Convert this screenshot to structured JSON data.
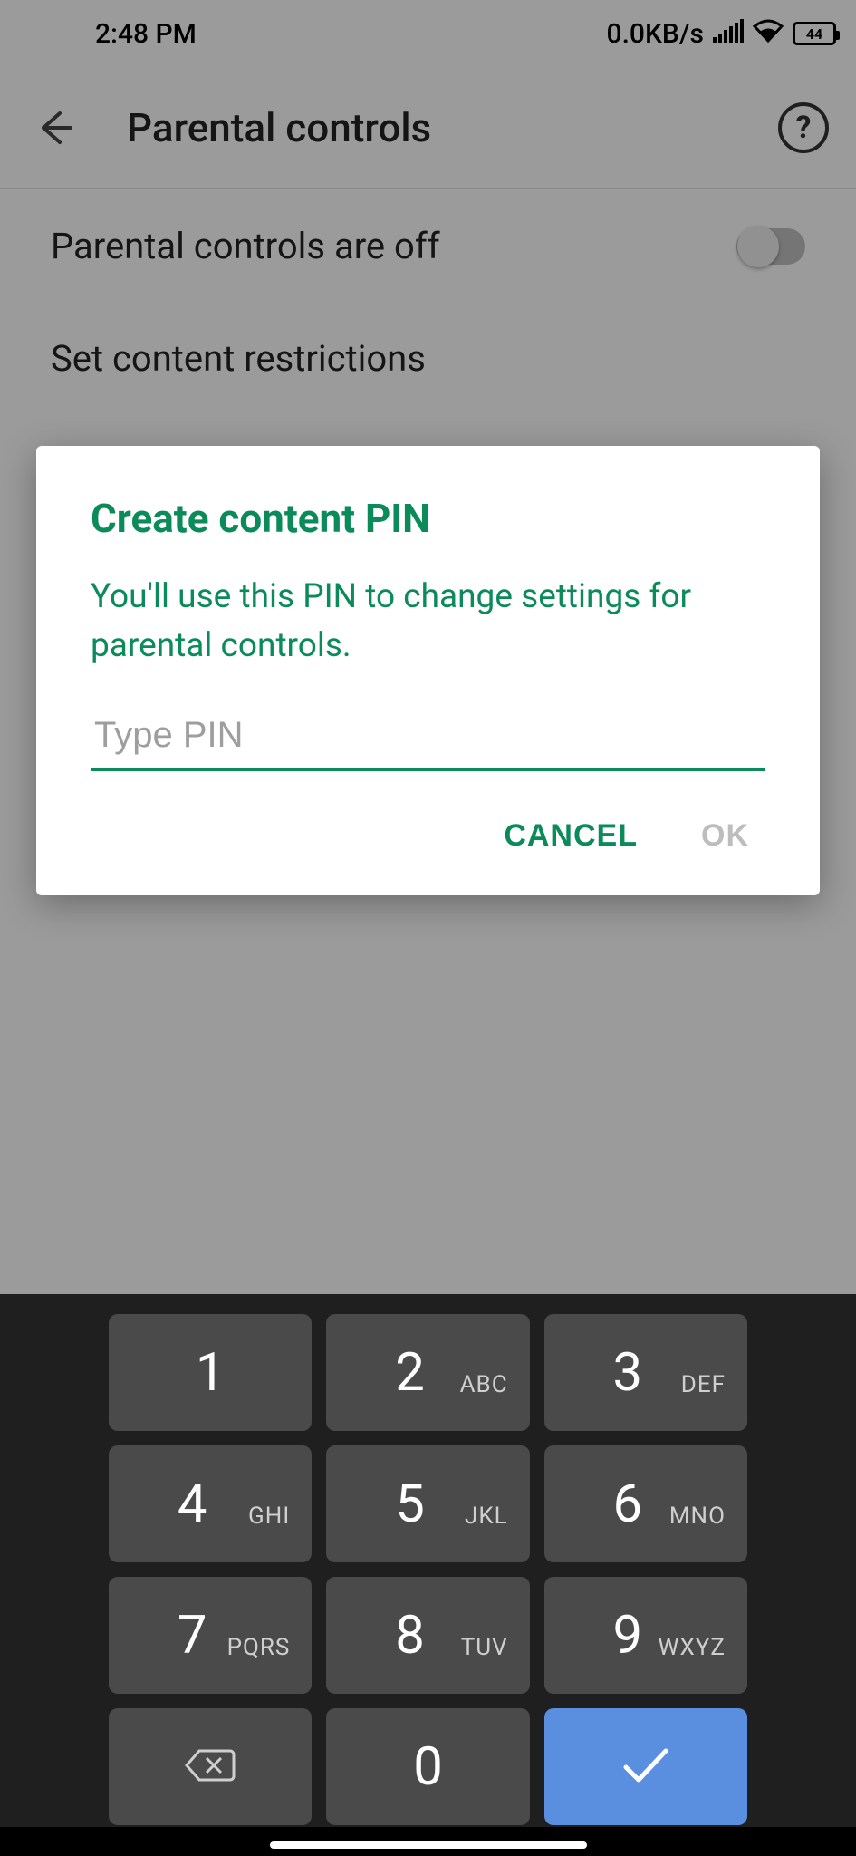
{
  "statusbar": {
    "time": "2:48 PM",
    "net_speed": "0.0KB/s",
    "battery_pct": "44"
  },
  "appbar": {
    "title": "Parental controls"
  },
  "page": {
    "toggle_row_label": "Parental controls are off",
    "section_label": "Set content restrictions"
  },
  "dialog": {
    "title": "Create content PIN",
    "body": "You'll use this PIN to change settings for parental controls.",
    "placeholder": "Type PIN",
    "cancel_label": "CANCEL",
    "ok_label": "OK"
  },
  "keyboard": {
    "keys": [
      {
        "num": "1",
        "sub": ""
      },
      {
        "num": "2",
        "sub": "ABC"
      },
      {
        "num": "3",
        "sub": "DEF"
      },
      {
        "num": "4",
        "sub": "GHI"
      },
      {
        "num": "5",
        "sub": "JKL"
      },
      {
        "num": "6",
        "sub": "MNO"
      },
      {
        "num": "7",
        "sub": "PQRS"
      },
      {
        "num": "8",
        "sub": "TUV"
      },
      {
        "num": "9",
        "sub": "WXYZ"
      },
      {
        "num": "",
        "sub": ""
      },
      {
        "num": "0",
        "sub": ""
      },
      {
        "num": "",
        "sub": ""
      }
    ]
  }
}
